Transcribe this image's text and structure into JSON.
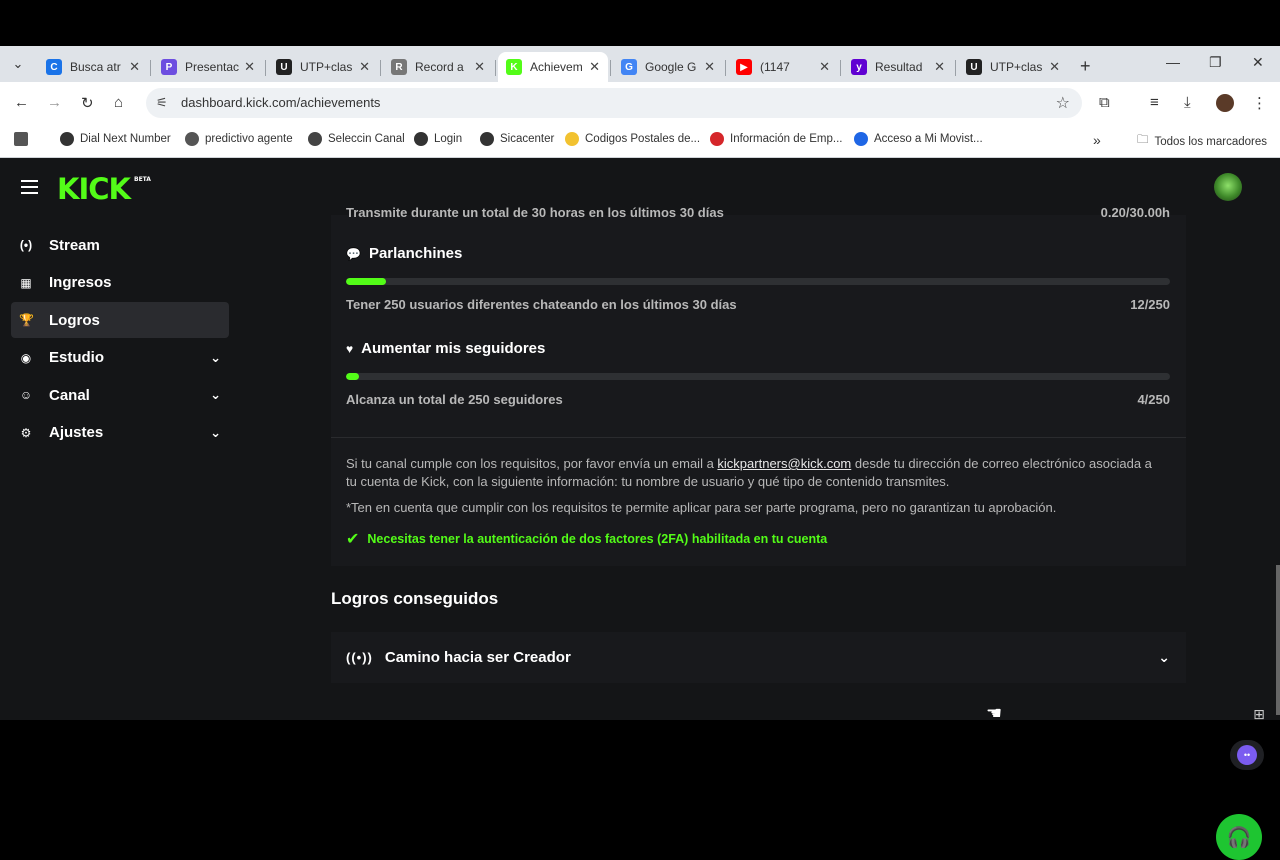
{
  "browser": {
    "tabs": [
      {
        "title": "Busca atr",
        "color": "#1a73e8",
        "letter": "C"
      },
      {
        "title": "Presentac",
        "color": "#6d4ee0",
        "letter": "P"
      },
      {
        "title": "UTP+clas",
        "color": "#222222",
        "letter": "U"
      },
      {
        "title": "Record a",
        "color": "#777777",
        "letter": "R"
      },
      {
        "title": "Achievem",
        "color": "#53fc18",
        "letter": "K"
      },
      {
        "title": "Google G",
        "color": "#4285f4",
        "letter": "G"
      },
      {
        "title": "(1147",
        "color": "#ff0000",
        "letter": "▶"
      },
      {
        "title": "Resultad",
        "color": "#6001d2",
        "letter": "y"
      },
      {
        "title": "UTP+clas",
        "color": "#222222",
        "letter": "U"
      }
    ],
    "active_tab_index": 4,
    "url": "dashboard.kick.com/achievements",
    "bookmarks": [
      "Dial Next Number",
      "predictivo agente",
      "Seleccin Canal",
      "Login",
      "Sicacenter",
      "Codigos Postales de...",
      "Información de Emp...",
      "Acceso a Mi Movist..."
    ],
    "all_bookmarks": "Todos los marcadores"
  },
  "app": {
    "logo": "KICK",
    "logo_badge": "BETA",
    "brand_color": "#53fc18",
    "sidebar": [
      {
        "label": "Stream",
        "icon": "broadcast-icon",
        "glyph": "(•)",
        "chevron": false
      },
      {
        "label": "Ingresos",
        "icon": "chart-icon",
        "glyph": "▦",
        "chevron": false
      },
      {
        "label": "Logros",
        "icon": "trophy-icon",
        "glyph": "🏆",
        "chevron": false
      },
      {
        "label": "Estudio",
        "icon": "studio-icon",
        "glyph": "◉",
        "chevron": true
      },
      {
        "label": "Canal",
        "icon": "users-icon",
        "glyph": "☺",
        "chevron": true
      },
      {
        "label": "Ajustes",
        "icon": "gear-icon",
        "glyph": "⚙",
        "chevron": true
      }
    ],
    "active_sidebar_index": 2
  },
  "achievements": {
    "cut_text": "Transmite durante un total de 30 horas en los últimos 30 días",
    "cut_value": "0.20/30.00h",
    "items": [
      {
        "title": "Parlanchines",
        "icon": "chat-icon",
        "glyph": "💬",
        "description": "Tener 250 usuarios diferentes chateando en los últimos 30 días",
        "value": "12/250",
        "progress": 0.048
      },
      {
        "title": "Aumentar mis seguidores",
        "icon": "heart-icon",
        "glyph": "♥",
        "description": "Alcanza un total de 250 seguidores",
        "value": "4/250",
        "progress": 0.016
      }
    ],
    "info_before_link": "Si tu canal cumple con los requisitos, por favor envía un email a ",
    "info_link": "kickpartners@kick.com",
    "info_after_link": " desde tu dirección de correo electrónico asociada a tu cuenta de Kick, con la siguiente información: tu nombre de usuario y qué tipo de contenido transmites.",
    "note": "*Ten en cuenta que cumplir con los requisitos te permite aplicar para ser parte programa, pero no garantizan tu aprobación.",
    "requirement": "Necesitas tener la autenticación de dos factores (2FA) habilitada en tu cuenta"
  },
  "completed": {
    "section_title": "Logros conseguidos",
    "accordion_label": "Camino hacia ser Creador"
  }
}
